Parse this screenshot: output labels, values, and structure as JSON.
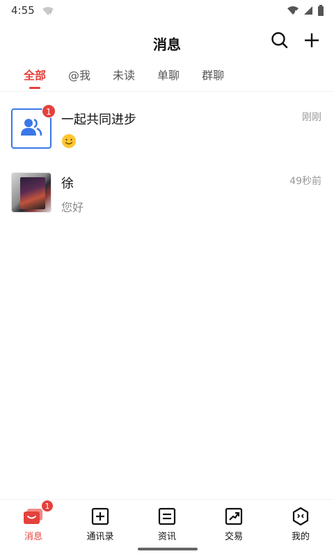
{
  "status_bar": {
    "time": "4:55",
    "icons": [
      "wifi-question-icon",
      "wifi-icon",
      "signal-icon",
      "battery-icon"
    ]
  },
  "header": {
    "title": "消息",
    "actions": [
      "search-icon",
      "plus-icon"
    ]
  },
  "tabs": [
    {
      "label": "全部",
      "active": true
    },
    {
      "label": "@我",
      "active": false
    },
    {
      "label": "未读",
      "active": false
    },
    {
      "label": "单聊",
      "active": false
    },
    {
      "label": "群聊",
      "active": false
    }
  ],
  "conversations": [
    {
      "name": "一起共同进步",
      "preview_emoji": "smile-emoji-icon",
      "time": "刚刚",
      "badge": "1",
      "avatar": "group-icon"
    },
    {
      "name": "徐",
      "preview": "您好",
      "time": "49秒前",
      "avatar": "photo"
    }
  ],
  "bottom_nav": [
    {
      "label": "消息",
      "icon": "message-icon",
      "active": true,
      "badge": "1"
    },
    {
      "label": "通讯录",
      "icon": "contacts-icon",
      "active": false
    },
    {
      "label": "资讯",
      "icon": "news-icon",
      "active": false
    },
    {
      "label": "交易",
      "icon": "trade-icon",
      "active": false
    },
    {
      "label": "我的",
      "icon": "profile-icon",
      "active": false
    }
  ],
  "colors": {
    "accent": "#e5413d",
    "group_avatar": "#3b77e8"
  }
}
